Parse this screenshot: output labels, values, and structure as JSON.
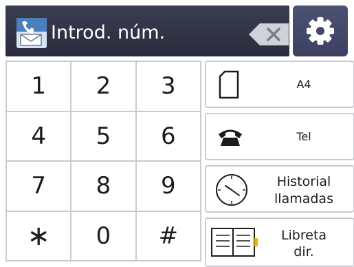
{
  "header": {
    "title": "Introd. núm."
  },
  "keypad": {
    "keys": [
      "1",
      "2",
      "3",
      "4",
      "5",
      "6",
      "7",
      "8",
      "9",
      "∗",
      "0",
      "#"
    ]
  },
  "side_buttons": {
    "paper_size": "A4",
    "tel": "Tel",
    "history_line1": "Historial",
    "history_line2": "llamadas",
    "address_line1": "Libreta",
    "address_line2": "dir."
  },
  "colors": {
    "header_bg": "#2e3043",
    "settings_bg": "#444866",
    "grid_lines": "#c9cbd3",
    "book_accent": "#f0b400"
  },
  "icons": {
    "fax": "fax-icon",
    "backspace": "backspace-icon",
    "settings": "gear-icon",
    "paper": "paper-icon",
    "tel": "telephone-icon",
    "history": "clock-icon",
    "address_book": "address-book-icon"
  }
}
